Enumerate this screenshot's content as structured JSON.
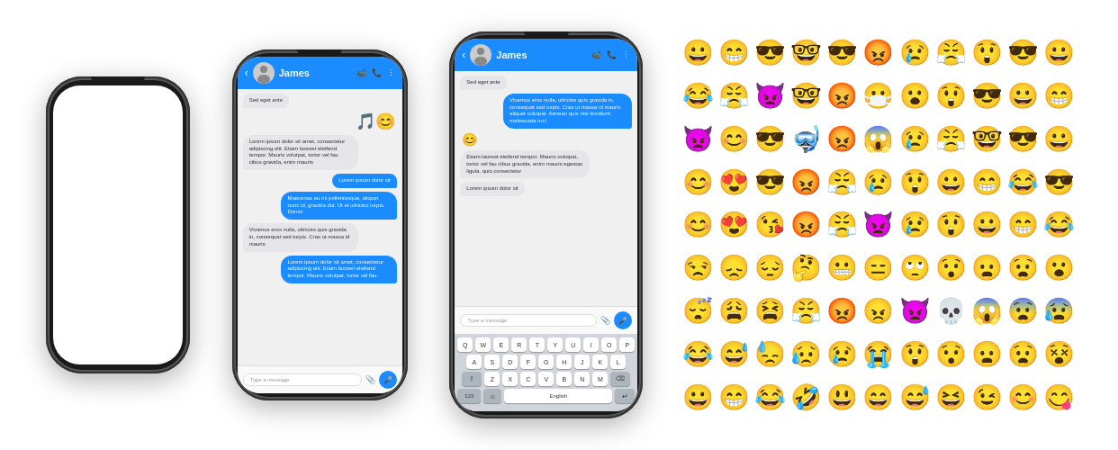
{
  "phones": {
    "phone1": {
      "label": "blank phone"
    },
    "phone2": {
      "contact": "James",
      "messages": [
        {
          "type": "received",
          "text": "Sed eget ante"
        },
        {
          "type": "sent_emoji",
          "emoji": "🎶😄"
        },
        {
          "type": "received",
          "text": "Lorem ipsum dolor sit amet, consectetur adipiscing elit. Etiam laoreet eleifend tempor. Mauris volutpat, tortor vel fau cibus gravida, enim mauris"
        },
        {
          "type": "sent",
          "text": "Lorem ipsum dolor sit"
        },
        {
          "type": "sent",
          "text": "Maecenas eu mi pellentesque, aliquet nunc id, gravida dui. Ut et ultricies turpis. Donec"
        },
        {
          "type": "received",
          "text": "Vivamus eros nulla, ultricies quis gravida in, consequat sed turpis. Cras ut massa id mauris"
        },
        {
          "type": "sent",
          "text": "Lorem ipsum dolor sit amet, consectetur adipiscing elit. Etiam laoreet eleifend tempor. Mauris volutpat, tortor vel fau-"
        }
      ],
      "input_placeholder": "Type a message"
    },
    "phone3": {
      "contact": "James",
      "messages": [
        {
          "type": "received",
          "text": "Sed eget ante"
        },
        {
          "type": "sent",
          "text": "Vivamus eros nulla, ultricies quis gravida in, consequat sed turpis. Cras ut massa id mauris aliquet volutpat. Aenean quis nisi tincidunt; malesuada orci"
        },
        {
          "type": "received_emoji",
          "emoji": "😊"
        },
        {
          "type": "received",
          "text": "Etiam laoreet eleifend tempor. Mauris volutpat, tortor vel fau cibus gravida, enim mauris egestas ligula, quis consectetur"
        },
        {
          "type": "received",
          "text": "Lorem ipsum dolor sit"
        }
      ],
      "input_placeholder": "Type a message",
      "keyboard": {
        "rows": [
          [
            "Q",
            "W",
            "E",
            "R",
            "T",
            "Y",
            "U",
            "I",
            "O",
            "P"
          ],
          [
            "A",
            "S",
            "D",
            "F",
            "G",
            "H",
            "J",
            "K",
            "L"
          ],
          [
            "⇧",
            "Z",
            "X",
            "C",
            "V",
            "B",
            "N",
            "M",
            "⌫"
          ],
          [
            "123",
            "☺",
            "English",
            "↵"
          ]
        ],
        "language": "English"
      }
    }
  },
  "emoji_grid": {
    "emojis": [
      "😀",
      "😁",
      "😎",
      "🤓",
      "😎",
      "😡",
      "😢",
      "😤",
      "😲",
      "😎",
      "😀",
      "😂",
      "😤",
      "👿",
      "🤓",
      "😡",
      "😷",
      "😮",
      "😲",
      "😎",
      "😀",
      "😁",
      "👿",
      "😊",
      "😎",
      "🤿",
      "😡",
      "😱",
      "😢",
      "😤",
      "🤓",
      "😎",
      "😀",
      "😊",
      "😍",
      "😎",
      "😡",
      "😤",
      "😢",
      "😲",
      "😀",
      "😁",
      "😂",
      "😎",
      "😊",
      "😍",
      "😘",
      "😡",
      "😤",
      "👿",
      "😢",
      "😲",
      "😀",
      "😁",
      "😂",
      "😒",
      "😞",
      "😔",
      "🤔",
      "😬",
      "😑",
      "🙄",
      "😯",
      "😦",
      "😧",
      "😮",
      "😴",
      "😩",
      "😫",
      "😤",
      "😡",
      "😠",
      "👿",
      "💀",
      "😱",
      "😨",
      "😰",
      "😂",
      "😅",
      "😓",
      "😥",
      "😢",
      "😭",
      "😲",
      "😯",
      "😦",
      "😧",
      "😵",
      "😀",
      "😁",
      "😂",
      "🤣",
      "😃",
      "😄",
      "😅",
      "😆",
      "😉",
      "😊",
      "😋"
    ]
  },
  "header": {
    "back": "‹",
    "video_icon": "📹",
    "call_icon": "📞",
    "more_icon": "⋮"
  }
}
